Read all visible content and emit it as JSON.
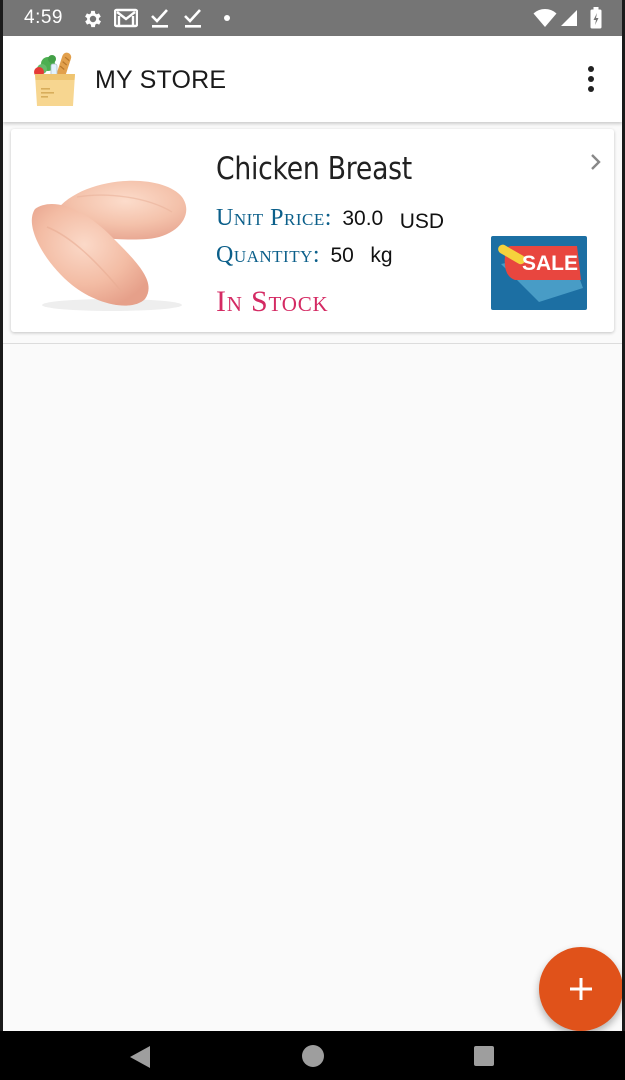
{
  "status_bar": {
    "time": "4:59",
    "icons": [
      "gear-icon",
      "gmail-icon",
      "check-icon",
      "check-icon",
      "dot-icon",
      "wifi-icon",
      "signal-icon",
      "battery-icon"
    ]
  },
  "app_bar": {
    "title": "MY STORE",
    "logo_icon": "grocery-bag-icon",
    "menu_icon": "overflow-menu-icon"
  },
  "products": [
    {
      "name": "Chicken Breast",
      "unit_price_label": "Unit Price:",
      "unit_price": "30.0",
      "currency": "USD",
      "quantity_label": "Quantity:",
      "quantity": "50",
      "unit": "kg",
      "stock_status": "In Stock",
      "badge_text": "SALE",
      "image_icon": "chicken-breast-image"
    }
  ],
  "fab": {
    "icon": "plus-icon",
    "color": "#e0521a"
  },
  "nav_bar": {
    "icons": [
      "back-icon",
      "home-icon",
      "recents-icon"
    ]
  },
  "colors": {
    "status_bar": "#757575",
    "label_blue": "#0b5f8a",
    "stock_pink": "#d42a63",
    "sale_blue": "#1c6fa3",
    "sale_red": "#e8463f"
  }
}
